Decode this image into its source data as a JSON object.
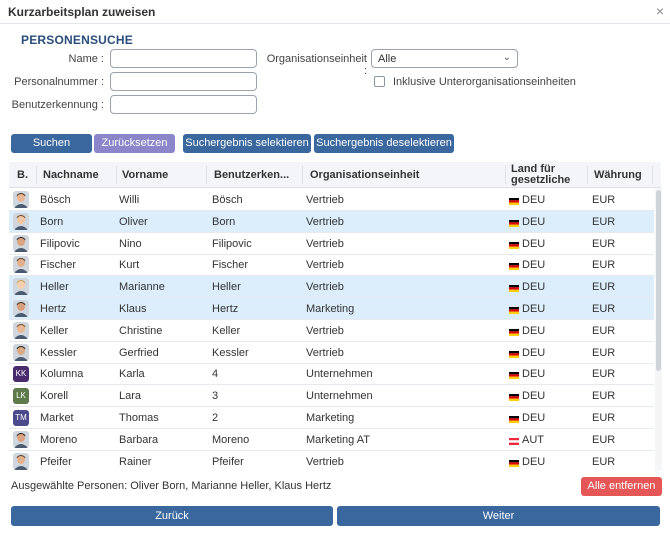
{
  "window": {
    "title": "Kurzarbeitsplan zuweisen",
    "close": "×"
  },
  "search": {
    "section_title": "PERSONENSUCHE",
    "name_label": "Name :",
    "personalnummer_label": "Personalnummer :",
    "benutzerkennung_label": "Benutzerkennung :",
    "org_label": "Organisationseinheit :",
    "org_value": "Alle",
    "include_sub_label": "Inklusive Unterorganisationseinheiten",
    "include_sub_checked": false
  },
  "buttons": {
    "search": "Suchen",
    "reset": "Zurücksetzen",
    "select_result": "Suchergebnis selektieren",
    "deselect_result": "Suchergebnis deselektieren",
    "remove_all": "Alle entfernen",
    "back": "Zurück",
    "next": "Weiter"
  },
  "table": {
    "columns": {
      "b": "B.",
      "nachname": "Nachname",
      "vorname": "Vorname",
      "benutzerkennung": "Benutzerken...",
      "org": "Organisationseinheit",
      "land_line1": "Land für",
      "land_line2": "gesetzliche",
      "waehrung": "Währung"
    },
    "rows": [
      {
        "nachname": "Bösch",
        "vorname": "Willi",
        "kennung": "Bösch",
        "org": "Vertrieb",
        "land": "DEU",
        "waehrung": "EUR",
        "selected": false,
        "avatar": "photo"
      },
      {
        "nachname": "Born",
        "vorname": "Oliver",
        "kennung": "Born",
        "org": "Vertrieb",
        "land": "DEU",
        "waehrung": "EUR",
        "selected": true,
        "avatar": "photo"
      },
      {
        "nachname": "Filipovic",
        "vorname": "Nino",
        "kennung": "Filipovic",
        "org": "Vertrieb",
        "land": "DEU",
        "waehrung": "EUR",
        "selected": false,
        "avatar": "photo"
      },
      {
        "nachname": "Fischer",
        "vorname": "Kurt",
        "kennung": "Fischer",
        "org": "Vertrieb",
        "land": "DEU",
        "waehrung": "EUR",
        "selected": false,
        "avatar": "photo"
      },
      {
        "nachname": "Heller",
        "vorname": "Marianne",
        "kennung": "Heller",
        "org": "Vertrieb",
        "land": "DEU",
        "waehrung": "EUR",
        "selected": true,
        "avatar": "photo"
      },
      {
        "nachname": "Hertz",
        "vorname": "Klaus",
        "kennung": "Hertz",
        "org": "Marketing",
        "land": "DEU",
        "waehrung": "EUR",
        "selected": true,
        "avatar": "photo"
      },
      {
        "nachname": "Keller",
        "vorname": "Christine",
        "kennung": "Keller",
        "org": "Vertrieb",
        "land": "DEU",
        "waehrung": "EUR",
        "selected": false,
        "avatar": "photo"
      },
      {
        "nachname": "Kessler",
        "vorname": "Gerfried",
        "kennung": "Kessler",
        "org": "Vertrieb",
        "land": "DEU",
        "waehrung": "EUR",
        "selected": false,
        "avatar": "photo"
      },
      {
        "nachname": "Kolumna",
        "vorname": "Karla",
        "kennung": "4",
        "org": "Unternehmen",
        "land": "DEU",
        "waehrung": "EUR",
        "selected": false,
        "avatar": "KK",
        "avatar_color": "#4a2c6e"
      },
      {
        "nachname": "Korell",
        "vorname": "Lara",
        "kennung": "3",
        "org": "Unternehmen",
        "land": "DEU",
        "waehrung": "EUR",
        "selected": false,
        "avatar": "LK",
        "avatar_color": "#5d7a4a"
      },
      {
        "nachname": "Market",
        "vorname": "Thomas",
        "kennung": "2",
        "org": "Marketing",
        "land": "DEU",
        "waehrung": "EUR",
        "selected": false,
        "avatar": "TM",
        "avatar_color": "#4b4a8c"
      },
      {
        "nachname": "Moreno",
        "vorname": "Barbara",
        "kennung": "Moreno",
        "org": "Marketing AT",
        "land": "AUT",
        "waehrung": "EUR",
        "selected": false,
        "avatar": "photo"
      },
      {
        "nachname": "Pfeifer",
        "vorname": "Rainer",
        "kennung": "Pfeifer",
        "org": "Vertrieb",
        "land": "DEU",
        "waehrung": "EUR",
        "selected": false,
        "avatar": "photo"
      }
    ]
  },
  "selected_persons_text": "Ausgewählte Personen: Oliver Born, Marianne Heller, Klaus Hertz",
  "colors": {
    "primary": "#3a679e",
    "secondary": "#8b85c9",
    "danger": "#e55757",
    "selected_row": "#dceefb",
    "section_title": "#2a4d7a"
  }
}
